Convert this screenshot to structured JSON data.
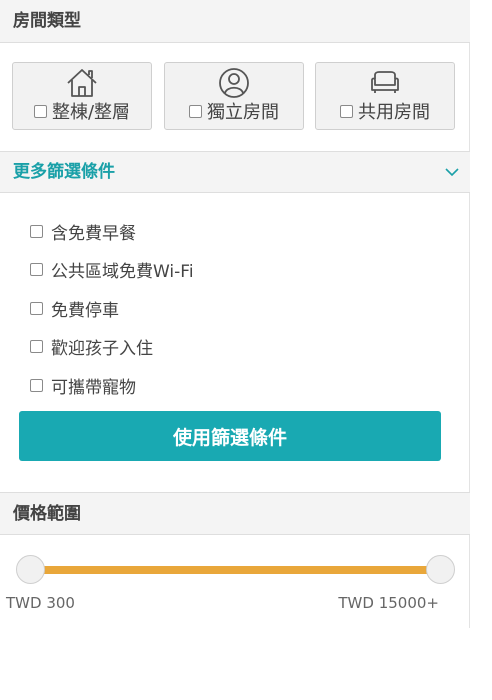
{
  "room_type": {
    "title": "房間類型",
    "options": [
      {
        "label": "整棟/整層",
        "icon": "house-icon",
        "checked": false
      },
      {
        "label": "獨立房間",
        "icon": "person-icon",
        "checked": false
      },
      {
        "label": "共用房間",
        "icon": "sofa-icon",
        "checked": false
      }
    ]
  },
  "more_filters": {
    "title": "更多篩選條件",
    "expanded": true,
    "items": [
      {
        "label": "含免費早餐",
        "checked": false
      },
      {
        "label": "公共區域免費Wi-Fi",
        "checked": false
      },
      {
        "label": "免費停車",
        "checked": false
      },
      {
        "label": "歡迎孩子入住",
        "checked": false
      },
      {
        "label": "可攜帶寵物",
        "checked": false
      }
    ],
    "apply_label": "使用篩選條件"
  },
  "price_range": {
    "title": "價格範圍",
    "min_label": "TWD 300",
    "max_label": "TWD 15000+",
    "min_value": 300,
    "max_value": 15000
  },
  "colors": {
    "accent": "#19a9b2",
    "slider_track": "#e9a73a"
  }
}
